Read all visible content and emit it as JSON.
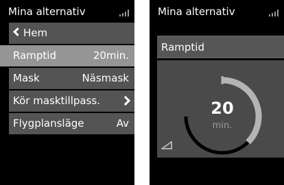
{
  "left_screen": {
    "title": "Mina alternativ",
    "menu": {
      "back_label": "Hem",
      "items": [
        {
          "label": "Ramptid",
          "value": "20min."
        },
        {
          "label": "Mask",
          "value": "Näsmask"
        },
        {
          "label": "Kör masktillpass.",
          "value": ""
        },
        {
          "label": "Flygplansläge",
          "value": "Av"
        }
      ]
    }
  },
  "right_screen": {
    "title": "Mina alternativ",
    "setting_label": "Ramptid",
    "gauge": {
      "value": "20",
      "unit": "min.",
      "level": 0.5
    }
  },
  "colors": {
    "screen_bg": "#000000",
    "row_bg": "#545454",
    "selected_bg": "#959595",
    "gauge_highlight": "#b4b4b4"
  },
  "icons": [
    "signal-icon",
    "chevron-left-icon",
    "chevron-right-icon",
    "ramp-icon"
  ]
}
